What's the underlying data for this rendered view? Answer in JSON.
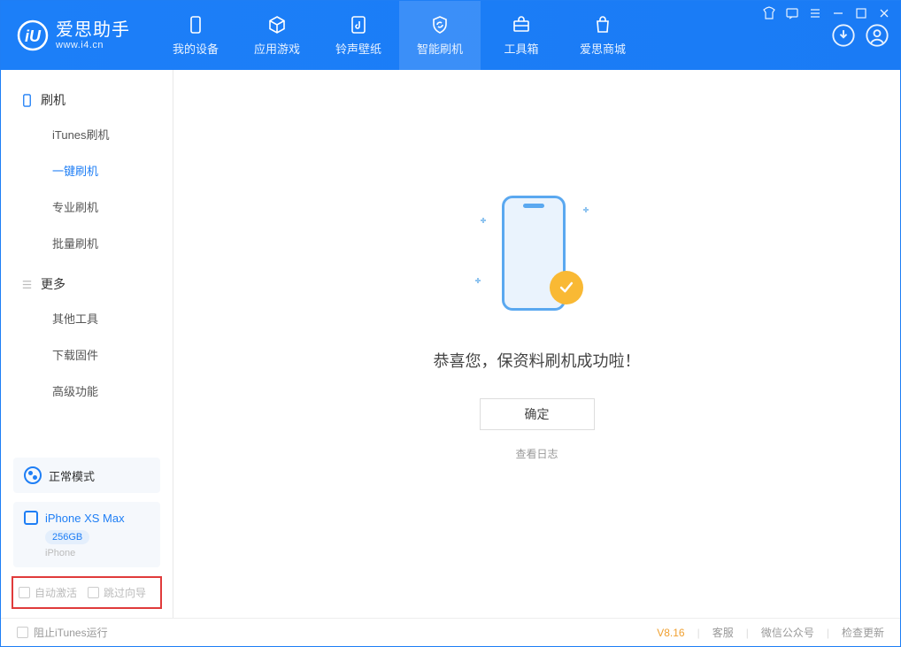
{
  "app": {
    "name": "爱思助手",
    "url": "www.i4.cn"
  },
  "tabs": {
    "device": "我的设备",
    "apps": "应用游戏",
    "ringtone": "铃声壁纸",
    "flash": "智能刷机",
    "toolbox": "工具箱",
    "store": "爱思商城"
  },
  "sidebar": {
    "group_flash": "刷机",
    "items_flash": [
      "iTunes刷机",
      "一键刷机",
      "专业刷机",
      "批量刷机"
    ],
    "group_more": "更多",
    "items_more": [
      "其他工具",
      "下载固件",
      "高级功能"
    ]
  },
  "mode": {
    "label": "正常模式"
  },
  "device": {
    "name": "iPhone XS Max",
    "storage": "256GB",
    "type": "iPhone"
  },
  "options": {
    "auto_activate": "自动激活",
    "skip_guide": "跳过向导"
  },
  "main": {
    "message": "恭喜您，保资料刷机成功啦！",
    "ok": "确定",
    "log_link": "查看日志"
  },
  "status": {
    "block_itunes": "阻止iTunes运行",
    "version": "V8.16",
    "support": "客服",
    "wechat": "微信公众号",
    "update": "检查更新"
  }
}
